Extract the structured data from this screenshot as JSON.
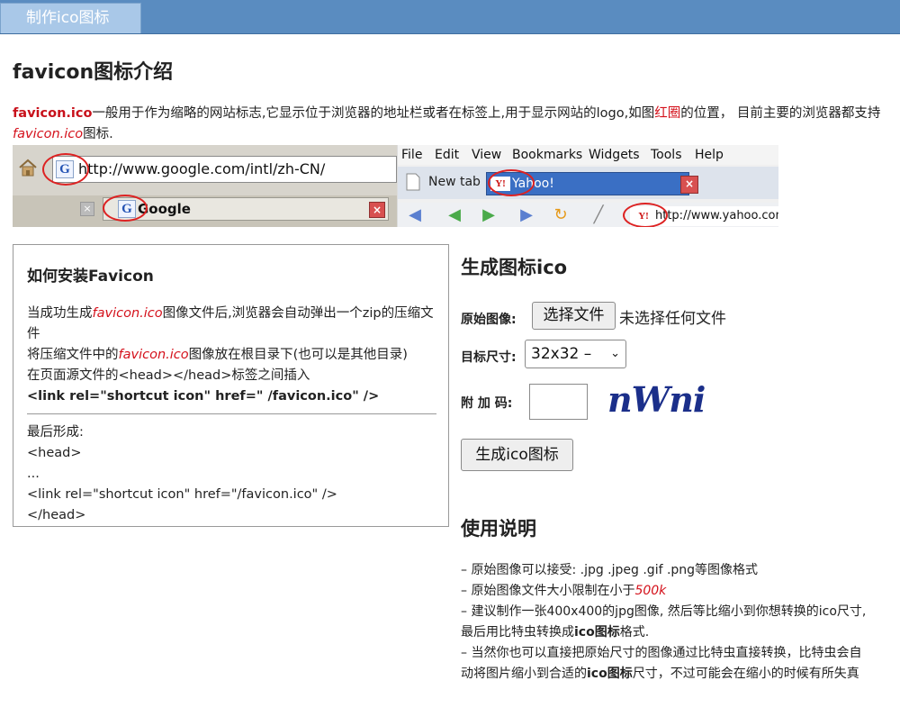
{
  "header": {
    "tab_label": "制作ico图标"
  },
  "intro": {
    "title": "favicon图标介绍",
    "lead": "favicon.ico",
    "text1": "一般用于作为缩略的网站标志,它显示位于浏览器的地址栏或者在标签上,用于显示网站的logo,如图",
    "red_circle": "红圈",
    "text2": "的位置， 目前主要的浏览器都支持",
    "favicon_italic": "favicon.ico",
    "text3": "图标."
  },
  "screenshot": {
    "url": "http://www.google.com/intl/zh-CN/",
    "g_icon": "G",
    "tab_google": "Google",
    "menu": [
      "File",
      "Edit",
      "View",
      "Bookmarks",
      "Widgets",
      "Tools",
      "Help"
    ],
    "new_tab": "New tab",
    "yahoo_tab": "Yahoo!",
    "yahoo_icon": "Y!",
    "yahoo_url": "http://www.yahoo.com"
  },
  "install": {
    "title": "如何安装Favicon",
    "l1a": "当成功生成",
    "l1b": "favicon.ico",
    "l1c": "图像文件后,浏览器会自动弹出一个zip的压缩文件",
    "l2a": "将压缩文件中的",
    "l2b": "favicon.ico",
    "l2c": "图像放在根目录下(也可以是其他目录)",
    "l3": "在页面源文件的<head></head>标签之间插入",
    "l4": "<link rel=\"shortcut icon\" href=\" /favicon.ico\" />",
    "l5": "最后形成:",
    "l6": "<head>",
    "l7": "...",
    "l8": "<link rel=\"shortcut icon\" href=\"/favicon.ico\" />",
    "l9": "</head>"
  },
  "form": {
    "title": "生成图标ico",
    "source_label": "原始图像:",
    "file_button": "选择文件",
    "file_status": "未选择任何文件",
    "size_label": "目标尺寸:",
    "size_value": "32x32 –",
    "code_label": "附 加 码:",
    "captcha": "nWni",
    "generate_button": "生成ico图标"
  },
  "usage": {
    "title": "使用说明",
    "i1": "– 原始图像可以接受: .jpg .jpeg .gif .png等图像格式",
    "i2a": "– 原始图像文件大小限制在小于",
    "i2b": "500k",
    "i3a": "– 建议制作一张400x400的jpg图像, 然后等比缩小到你想转换的ico尺寸,最后用比特虫转换成",
    "i3b": "ico图标",
    "i3c": "格式.",
    "i4a": "– 当然你也可以直接把原始尺寸的图像通过比特虫直接转换，比特虫会自动将图片缩小到合适的",
    "i4b": "ico图标",
    "i4c": "尺寸，不过可能会在缩小的时候有所失真"
  }
}
